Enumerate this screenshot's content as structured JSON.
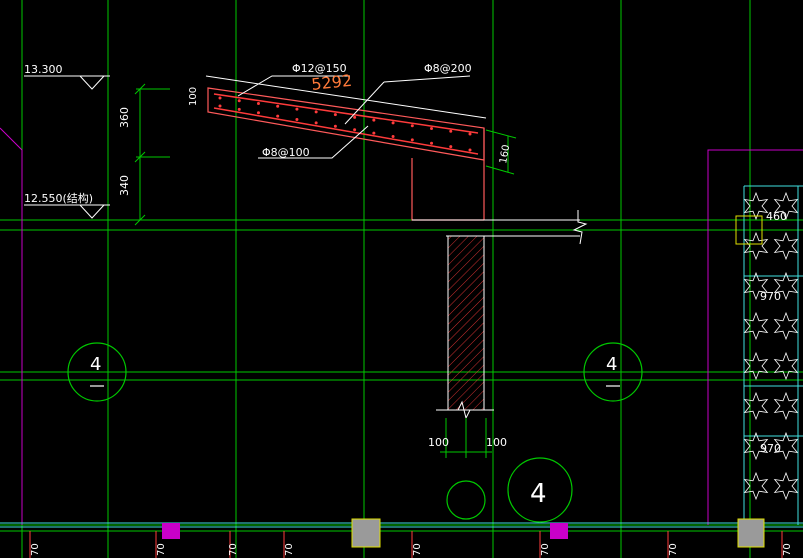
{
  "colors": {
    "background": "#000000",
    "grid": "#00c800",
    "text": "#ffffff",
    "dim": "#ffffff",
    "rebar": "#ff3b3b",
    "outline": "#ff5a5a",
    "highlight": "#ff7a3a",
    "boundary": "#c800c8",
    "cyan": "#40e0e0",
    "yellow": "#e0e000"
  },
  "levels": {
    "top": "13.300",
    "bottom": "12.550(结构)"
  },
  "vertical_dims": {
    "upper": "360",
    "lower": "340"
  },
  "rebar_labels": {
    "main": "Φ12@150",
    "distribution": "Φ8@200",
    "stirrup": "Φ8@100"
  },
  "slope_length": "5292",
  "slab_dims": {
    "left_thickness": "100",
    "right_thickness": "160"
  },
  "wall_dims": {
    "left": "100",
    "right": "100"
  },
  "right_panel_dims": [
    "460",
    "970",
    "970"
  ],
  "axis_markers": [
    {
      "id": "left",
      "label": "4"
    },
    {
      "id": "right",
      "label": "4"
    },
    {
      "id": "bottom",
      "label": "4"
    }
  ],
  "bottom_labels": [
    "70",
    "70",
    "70",
    "70",
    "70",
    "70",
    "70",
    "70"
  ]
}
